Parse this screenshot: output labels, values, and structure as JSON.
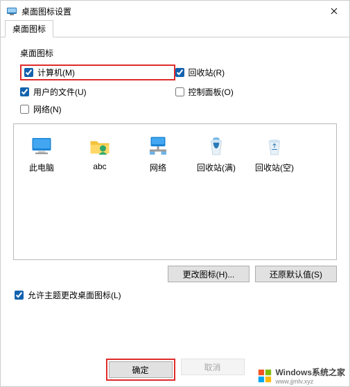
{
  "title": "桌面图标设置",
  "tab_label": "桌面图标",
  "group_label": "桌面图标",
  "checks": {
    "computer": "计算机(M)",
    "recycle": "回收站(R)",
    "userfiles": "用户的文件(U)",
    "controlpanel": "控制面板(O)",
    "network": "网络(N)"
  },
  "icons": {
    "thispc": "此电脑",
    "abc": "abc",
    "network_lbl": "网络",
    "recycle_full": "回收站(满)",
    "recycle_empty": "回收站(空)"
  },
  "buttons": {
    "change_icon": "更改图标(H)...",
    "restore_default": "还原默认值(S)",
    "ok": "确定",
    "cancel": "取消"
  },
  "allow_theme": "允许主题更改桌面图标(L)",
  "watermark": "Windows系统之家",
  "watermark_sub": "www.jjmlv.xyz"
}
